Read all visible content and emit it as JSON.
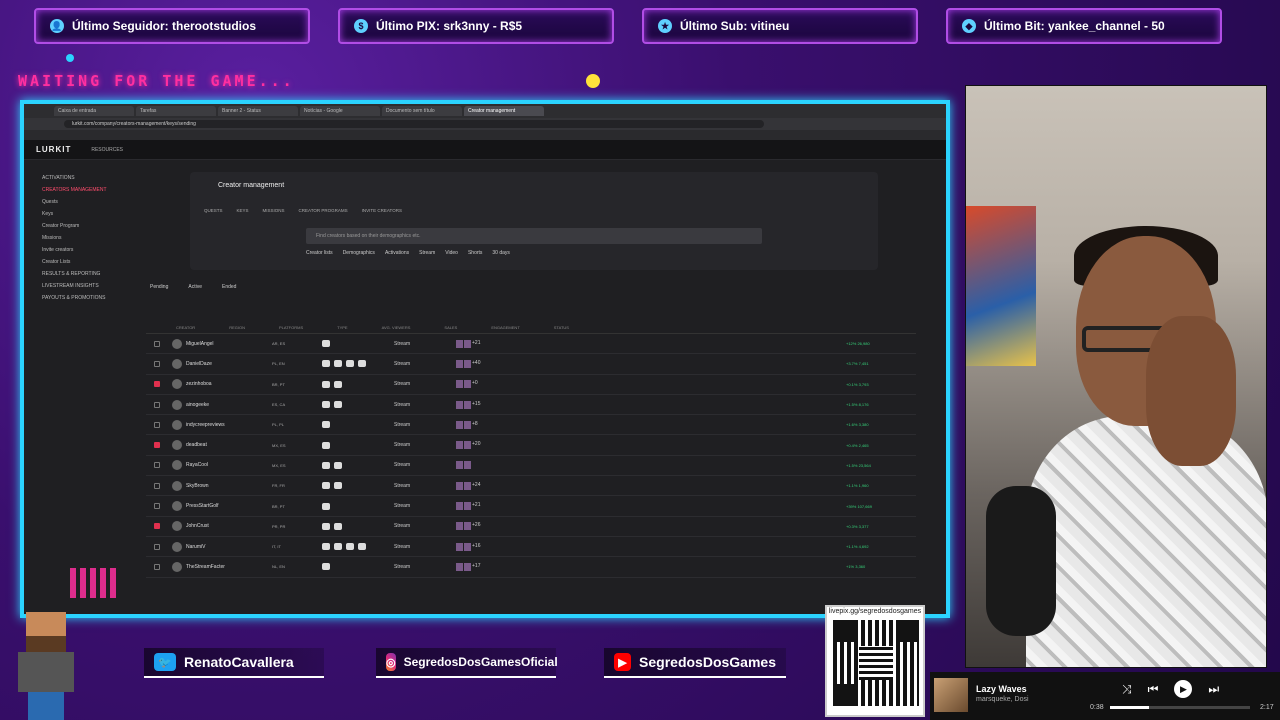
{
  "alerts": {
    "follower": "Último Seguidor: therootstudios",
    "pix": "Último PIX: srk3nny - R$5",
    "sub": "Último Sub: vitineu",
    "bit": "Último Bit: yankee_channel - 50"
  },
  "waiting_text": "WAITING FOR THE GAME...",
  "browser": {
    "tabs": [
      "Caixa de entrada",
      "Tarefas",
      "Banner 2 - Status",
      "Notícias - Google",
      "Documento sem título",
      "Creator management"
    ],
    "active_tab": 5,
    "url": "lurkit.com/company/creators-management/keys/sending"
  },
  "app": {
    "logo": "LURKIT",
    "resources": "RESOURCES",
    "sidebar": [
      {
        "label": "ACTIVATIONS",
        "hl": false
      },
      {
        "label": "CREATORS MANAGEMENT",
        "hl": true
      },
      {
        "label": "Quests",
        "hl": false
      },
      {
        "label": "Keys",
        "hl": false
      },
      {
        "label": "Creator Program",
        "hl": false
      },
      {
        "label": "Missions",
        "hl": false
      },
      {
        "label": "Invite creators",
        "hl": false
      },
      {
        "label": "Creator Lists",
        "hl": false
      },
      {
        "label": "RESULTS & REPORTING",
        "hl": false
      },
      {
        "label": "LIVESTREAM INSIGHTS",
        "hl": false
      },
      {
        "label": "PAYOUTS & PROMOTIONS",
        "hl": false
      }
    ],
    "panel_title": "Creator management",
    "subtabs": [
      "QUESTS",
      "KEYS",
      "MISSIONS",
      "CREATOR PROGRAMS",
      "INVITE CREATORS"
    ],
    "search_placeholder": "Find creators based on their demographics etc.",
    "filters": [
      "Creator lists",
      "Demographics",
      "Activations",
      "Stream",
      "Video",
      "Shorts",
      "30 days"
    ],
    "state_tabs": [
      "Pending",
      "Active",
      "Ended"
    ],
    "columns": [
      "CREATOR",
      "REGION",
      "PLATFORMS",
      "TYPE",
      "AVG. VIEWERS",
      "SALES",
      "ENGAGEMENT",
      "STATUS"
    ],
    "rows": [
      {
        "name": "MiguelAngel",
        "cc": "AR, ES",
        "checked": false,
        "plats": 1,
        "badge": "+21",
        "tail": "+12% 26,980"
      },
      {
        "name": "DanielDaze",
        "cc": "PL, EN",
        "checked": false,
        "plats": 4,
        "badge": "+40",
        "tail": "+3.7% 7,451"
      },
      {
        "name": "zezinhoboa",
        "cc": "BR, PT",
        "checked": true,
        "plats": 2,
        "badge": "+0",
        "tail": "+0.1% 3,793"
      },
      {
        "name": "ainogeeke",
        "cc": "ES, CA",
        "checked": false,
        "plats": 2,
        "badge": "+15",
        "tail": "+1.5% 8,176"
      },
      {
        "name": "indycreepreviews",
        "cc": "PL, PL",
        "checked": false,
        "plats": 1,
        "badge": "+8",
        "tail": "+1.6% 3,380"
      },
      {
        "name": "deadbeat",
        "cc": "MX, ES",
        "checked": true,
        "plats": 1,
        "badge": "+20",
        "tail": "+0.4% 2,465"
      },
      {
        "name": "RayaCool",
        "cc": "MX, ES",
        "checked": false,
        "plats": 2,
        "badge": "",
        "tail": "+1.5% 23,564"
      },
      {
        "name": "SkyBrown",
        "cc": "FR, FR",
        "checked": false,
        "plats": 2,
        "badge": "+24",
        "tail": "+1.1% 1,960"
      },
      {
        "name": "PressStartGolf",
        "cc": "BR, PT",
        "checked": false,
        "plats": 1,
        "badge": "+21",
        "tail": "+39% 107,669"
      },
      {
        "name": "JohnCrust",
        "cc": "PR, PR",
        "checked": true,
        "plats": 2,
        "badge": "+26",
        "tail": "+0.3% 3,377"
      },
      {
        "name": "NarumiV",
        "cc": "IT, IT",
        "checked": false,
        "plats": 4,
        "badge": "+16",
        "tail": "+1.1% 4,692"
      },
      {
        "name": "TheStreamFacter",
        "cc": "NL, EN",
        "checked": false,
        "plats": 1,
        "badge": "+17",
        "tail": "+1% 3,360"
      }
    ],
    "type_label": "Stream"
  },
  "socials": {
    "twitter": "RenatoCavallera",
    "instagram": "SegredosDosGamesOficial",
    "youtube": "SegredosDosGames"
  },
  "qr_url": "livepix.gg/segredosdosgames",
  "music": {
    "song": "Lazy Waves",
    "artist": "marsqueke, Dosi",
    "current": "0:38",
    "total": "2:17",
    "progress": 0.28
  },
  "colors": {
    "accent": "#2bd3ff",
    "brand_red": "#e0304e",
    "neon_pink": "#ff2fa0"
  }
}
